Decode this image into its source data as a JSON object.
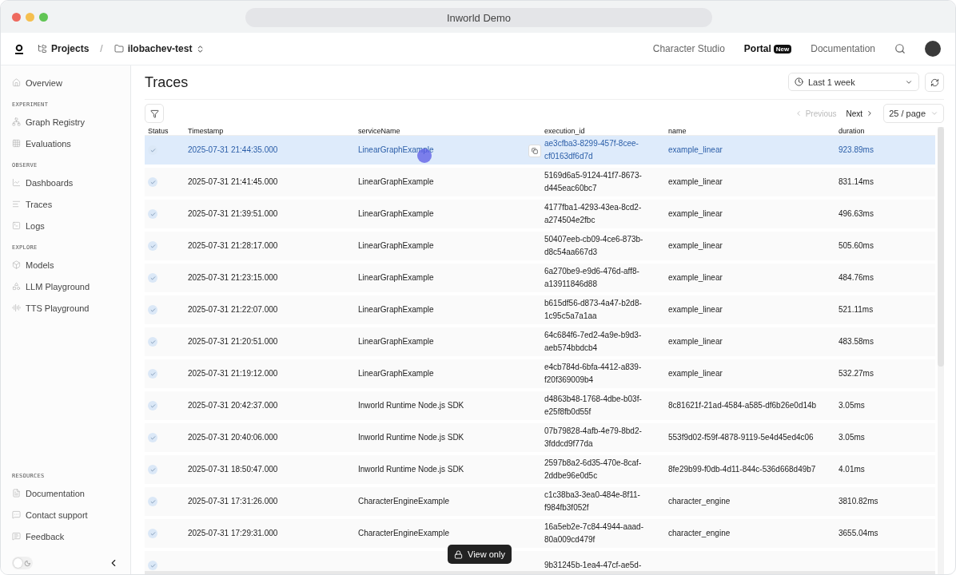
{
  "window": {
    "title": "Inworld Demo"
  },
  "breadcrumb": {
    "root": "Projects",
    "separator": "/",
    "project": "ilobachev-test"
  },
  "top_nav": [
    {
      "label": "Character Studio",
      "selected": false
    },
    {
      "label": "Portal",
      "selected": true,
      "badge": "New"
    },
    {
      "label": "Documentation",
      "selected": false
    }
  ],
  "sidebar": {
    "sections": [
      {
        "items": [
          {
            "label": "Overview",
            "selected": false
          }
        ]
      },
      {
        "label": "EXPERIMENT",
        "items": [
          {
            "label": "Graph Registry",
            "selected": false
          },
          {
            "label": "Evaluations",
            "selected": false
          }
        ]
      },
      {
        "label": "OBSERVE",
        "items": [
          {
            "label": "Dashboards",
            "selected": false
          },
          {
            "label": "Traces",
            "selected": false
          },
          {
            "label": "Logs",
            "selected": false
          }
        ]
      },
      {
        "label": "EXPLORE",
        "items": [
          {
            "label": "Models",
            "selected": false
          },
          {
            "label": "LLM Playground",
            "selected": false
          },
          {
            "label": "TTS Playground",
            "selected": false
          }
        ]
      }
    ],
    "resources": {
      "label": "RESOURCES",
      "items": [
        {
          "label": "Documentation",
          "selected": false
        },
        {
          "label": "Contact support",
          "selected": false
        },
        {
          "label": "Feedback",
          "selected": false
        }
      ]
    },
    "dark_mode": false
  },
  "page": {
    "title": "Traces",
    "range": "Last 1 week"
  },
  "pagination": {
    "previous": "Previous",
    "previous_disabled": true,
    "next": "Next",
    "next_disabled": false,
    "page_size": "25 / page"
  },
  "table": {
    "columns": [
      "Status",
      "Timestamp",
      "serviceName",
      "execution_id",
      "name",
      "duration"
    ],
    "rows": [
      {
        "selected": true,
        "ok": true,
        "timestamp": "2025-07-31 21:44:35.000",
        "service": "LinearGraphExample",
        "execution_id": [
          "ae3cfba3-8299-457f-8cee-",
          "cf0163df6d7d"
        ],
        "name": "example_linear",
        "duration": "923.89ms"
      },
      {
        "selected": false,
        "ok": true,
        "timestamp": "2025-07-31 21:41:45.000",
        "service": "LinearGraphExample",
        "execution_id": [
          "5169d6a5-9124-41f7-8673-",
          "d445eac60bc7"
        ],
        "name": "example_linear",
        "duration": "831.14ms"
      },
      {
        "selected": false,
        "ok": true,
        "timestamp": "2025-07-31 21:39:51.000",
        "service": "LinearGraphExample",
        "execution_id": [
          "4177fba1-4293-43ea-8cd2-",
          "a274504e2fbc"
        ],
        "name": "example_linear",
        "duration": "496.63ms"
      },
      {
        "selected": false,
        "ok": true,
        "timestamp": "2025-07-31 21:28:17.000",
        "service": "LinearGraphExample",
        "execution_id": [
          "50407eeb-cb09-4ce6-873b-",
          "d8c54aa667d3"
        ],
        "name": "example_linear",
        "duration": "505.60ms"
      },
      {
        "selected": false,
        "ok": true,
        "timestamp": "2025-07-31 21:23:15.000",
        "service": "LinearGraphExample",
        "execution_id": [
          "6a270be9-e9d6-476d-aff8-",
          "a13911846d88"
        ],
        "name": "example_linear",
        "duration": "484.76ms"
      },
      {
        "selected": false,
        "ok": true,
        "timestamp": "2025-07-31 21:22:07.000",
        "service": "LinearGraphExample",
        "execution_id": [
          "b615df56-d873-4a47-b2d8-",
          "1c95c5a7a1aa"
        ],
        "name": "example_linear",
        "duration": "521.11ms"
      },
      {
        "selected": false,
        "ok": true,
        "timestamp": "2025-07-31 21:20:51.000",
        "service": "LinearGraphExample",
        "execution_id": [
          "64c684f6-7ed2-4a9e-b9d3-",
          "aeb574bbdcb4"
        ],
        "name": "example_linear",
        "duration": "483.58ms"
      },
      {
        "selected": false,
        "ok": true,
        "timestamp": "2025-07-31 21:19:12.000",
        "service": "LinearGraphExample",
        "execution_id": [
          "e4cb784d-6bfa-4412-a839-",
          "f20f369009b4"
        ],
        "name": "example_linear",
        "duration": "532.27ms"
      },
      {
        "selected": false,
        "ok": true,
        "timestamp": "2025-07-31 20:42:37.000",
        "service": "Inworld Runtime Node.js SDK",
        "execution_id": [
          "d4863b48-1768-4dbe-b03f-",
          "e25f8fb0d55f"
        ],
        "name": "8c81621f-21ad-4584-a585-df6b26e0d14b",
        "duration": "3.05ms"
      },
      {
        "selected": false,
        "ok": true,
        "timestamp": "2025-07-31 20:40:06.000",
        "service": "Inworld Runtime Node.js SDK",
        "execution_id": [
          "07b79828-4afb-4e79-8bd2-",
          "3fddcd9f77da"
        ],
        "name": "553f9d02-f59f-4878-9119-5e4d45ed4c06",
        "duration": "3.05ms"
      },
      {
        "selected": false,
        "ok": true,
        "timestamp": "2025-07-31 18:50:47.000",
        "service": "Inworld Runtime Node.js SDK",
        "execution_id": [
          "2597b8a2-6d35-470e-8caf-",
          "2ddbe96e0d5c"
        ],
        "name": "8fe29b99-f0db-4d11-844c-536d668d49b7",
        "duration": "4.01ms"
      },
      {
        "selected": false,
        "ok": true,
        "timestamp": "2025-07-31 17:31:26.000",
        "service": "CharacterEngineExample",
        "execution_id": [
          "c1c38ba3-3ea0-484e-8f11-",
          "f984fb3f052f"
        ],
        "name": "character_engine",
        "duration": "3810.82ms"
      },
      {
        "selected": false,
        "ok": true,
        "timestamp": "2025-07-31 17:29:31.000",
        "service": "CharacterEngineExample",
        "execution_id": [
          "16a5eb2e-7c84-4944-aaad-",
          "80a009cd479f"
        ],
        "name": "character_engine",
        "duration": "3655.04ms"
      },
      {
        "selected": false,
        "ok": true,
        "execution_id": [
          "9b31245b-1ea4-47cf-ae5d-"
        ]
      }
    ]
  },
  "toast": {
    "label": "View only"
  }
}
